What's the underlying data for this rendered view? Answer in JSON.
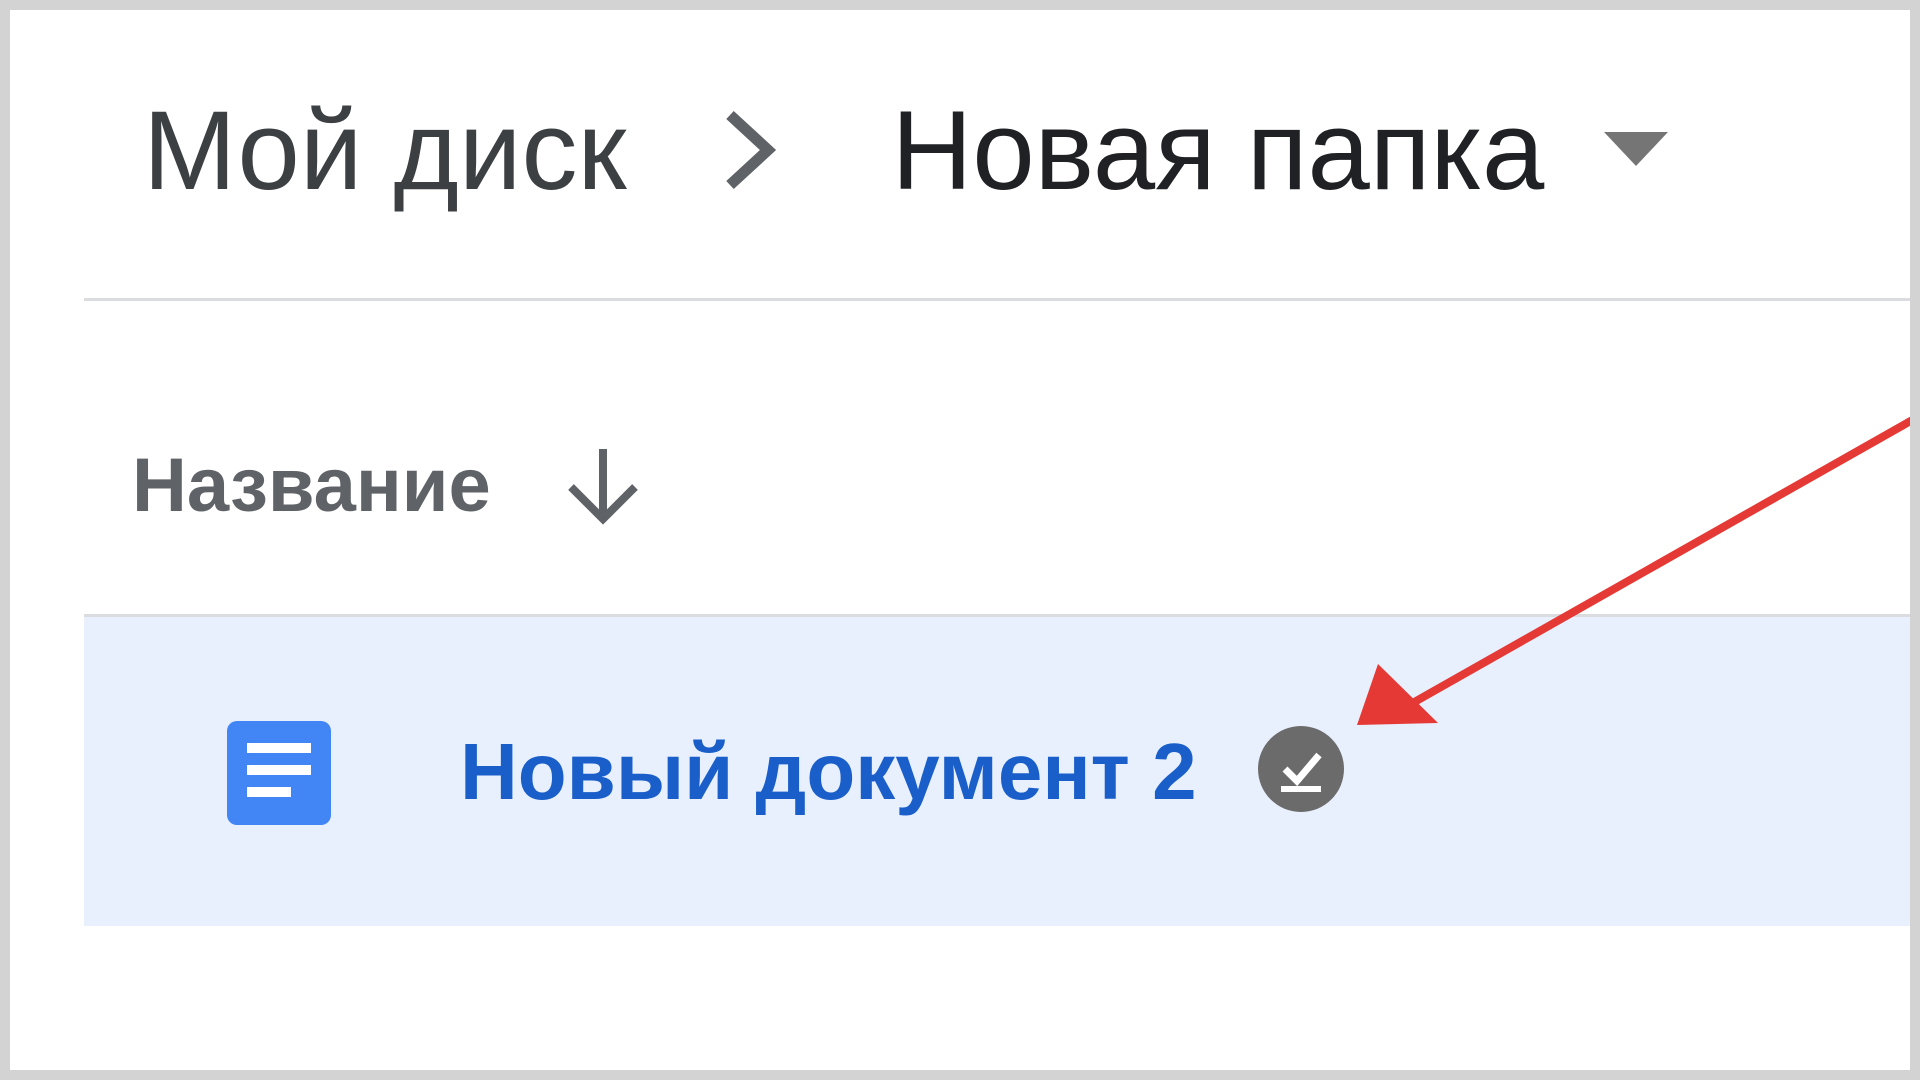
{
  "breadcrumb": {
    "root_label": "Мой диск",
    "current_label": "Новая папка"
  },
  "file_list": {
    "column_header": "Название",
    "sort_direction": "descending",
    "rows": [
      {
        "name": "Новый документ 2",
        "type_icon": "google-docs-icon",
        "status_icon": "available-offline-icon",
        "selected": true
      }
    ]
  },
  "colors": {
    "selection_background": "#e8f0fe",
    "file_name_text": "#1a5fc9",
    "docs_icon_blue": "#4285f4",
    "annotation_arrow": "#e53935"
  }
}
